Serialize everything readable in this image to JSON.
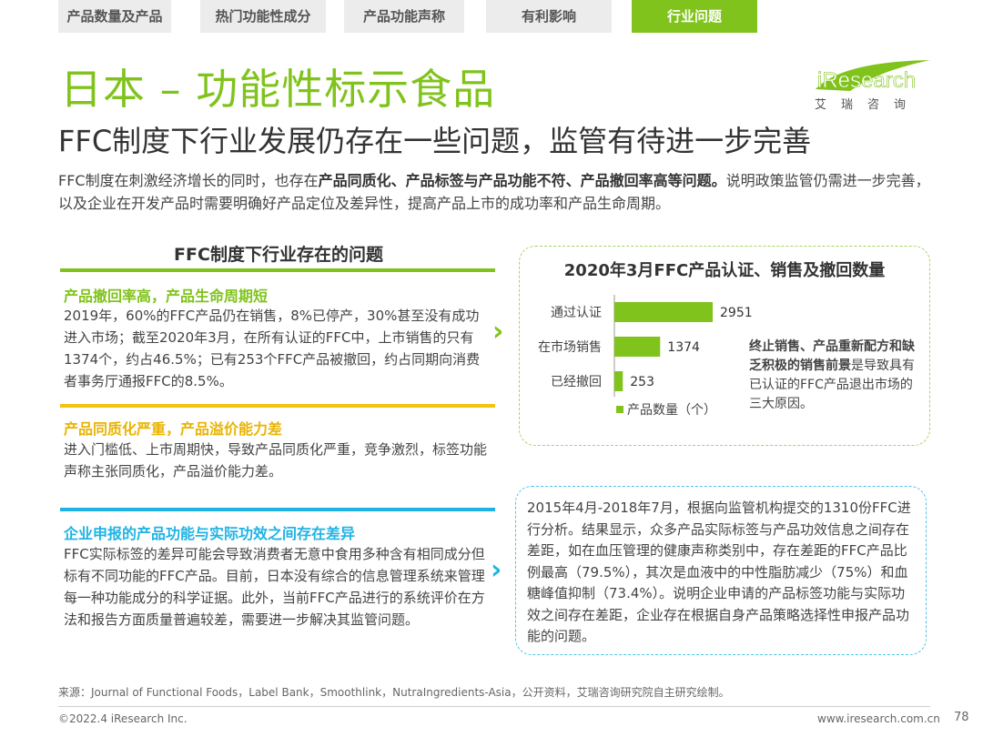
{
  "tabs": [
    {
      "label": "产品数量及产品",
      "active": false
    },
    {
      "label": "热门功能性成分",
      "active": false
    },
    {
      "label": "产品功能声称",
      "active": false
    },
    {
      "label": "有利影响",
      "active": false
    },
    {
      "label": "行业问题",
      "active": true
    }
  ],
  "colors": {
    "green": "#80c31c",
    "yellow": "#f2c30f",
    "blue": "#1fb3e5"
  },
  "header": {
    "title": "日本 – 功能性标示食品",
    "logo_text": "iResearch",
    "logo_sub": "艾瑞咨询",
    "subtitle": "FFC制度下行业发展仍存在一些问题，监管有待进一步完善"
  },
  "intro": {
    "part1": "FFC制度在刺激经济增长的同时，也存在",
    "bold": "产品同质化、产品标签与产品功能不符、产品撤回率高等问题。",
    "part2": "说明政策监管仍需进一步完善，以及企业在开发产品时需要明确好产品定位及差异性，提高产品上市的成功率和产品生命周期。"
  },
  "issues": {
    "title": "FFC制度下行业存在的问题",
    "items": [
      {
        "heading": "产品撤回率高，产品生命周期短",
        "color": "green",
        "body": "2019年，60%的FFC产品仍在销售，8%已停产，30%甚至没有成功进入市场；截至2020年3月，在所有认证的FFC中，上市销售的只有1374个，约占46.5%；已有253个FFC产品被撤回，约占同期向消费者事务厅通报FFC的8.5%。"
      },
      {
        "heading": "产品同质化严重，产品溢价能力差",
        "color": "yellow",
        "body": "进入门槛低、上市周期快，导致产品同质化严重，竞争激烈，标签功能声称主张同质化，产品溢价能力差。"
      },
      {
        "heading": "企业申报的产品功能与实际功效之间存在差异",
        "color": "blue",
        "body": "FFC实际标签的差异可能会导致消费者无意中食用多种含有相同成分但标有不同功能的FFC产品。目前，日本没有综合的信息管理系统来管理每一种功能成分的科学证据。此外，当前FFC产品进行的系统评价在方法和报告方面质量普遍较差，需要进一步解决其监管问题。"
      }
    ]
  },
  "chart_data": {
    "type": "bar",
    "orientation": "horizontal",
    "title": "2020年3月FFC产品认证、销售及撤回数量",
    "categories": [
      "通过认证",
      "在市场销售",
      "已经撤回"
    ],
    "series": [
      {
        "name": "产品数量（个）",
        "values": [
          2951,
          1374,
          253
        ]
      }
    ],
    "legend": "bottom",
    "grid": false,
    "xlim": [
      0,
      2951
    ],
    "color": "#80c31c"
  },
  "chart_note": {
    "bold": "终止销售、产品重新配方和缺乏积极的销售前景",
    "rest": "是导致具有已认证的FFC产品退出市场的三大原因。"
  },
  "study_text": "2015年4月-2018年7月，根据向监管机构提交的1310份FFC进行分析。结果显示，众多产品实际标签与产品功效信息之间存在差距，如在血压管理的健康声称类别中，存在差距的FFC产品比例最高（79.5%），其次是血液中的中性脂肪减少（75%）和血糖峰值抑制（73.4%）。说明企业申请的产品标签功能与实际功效之间存在差距，企业存在根据自身产品策略选择性申报产品功能的问题。",
  "footer": {
    "source": "来源：Journal of Functional Foods，Label Bank，Smoothlink，NutraIngredients-Asia，公开资料，艾瑞咨询研究院自主研究绘制。",
    "copyright": "©2022.4 iResearch Inc.",
    "url": "www.iresearch.com.cn",
    "page": "78"
  }
}
